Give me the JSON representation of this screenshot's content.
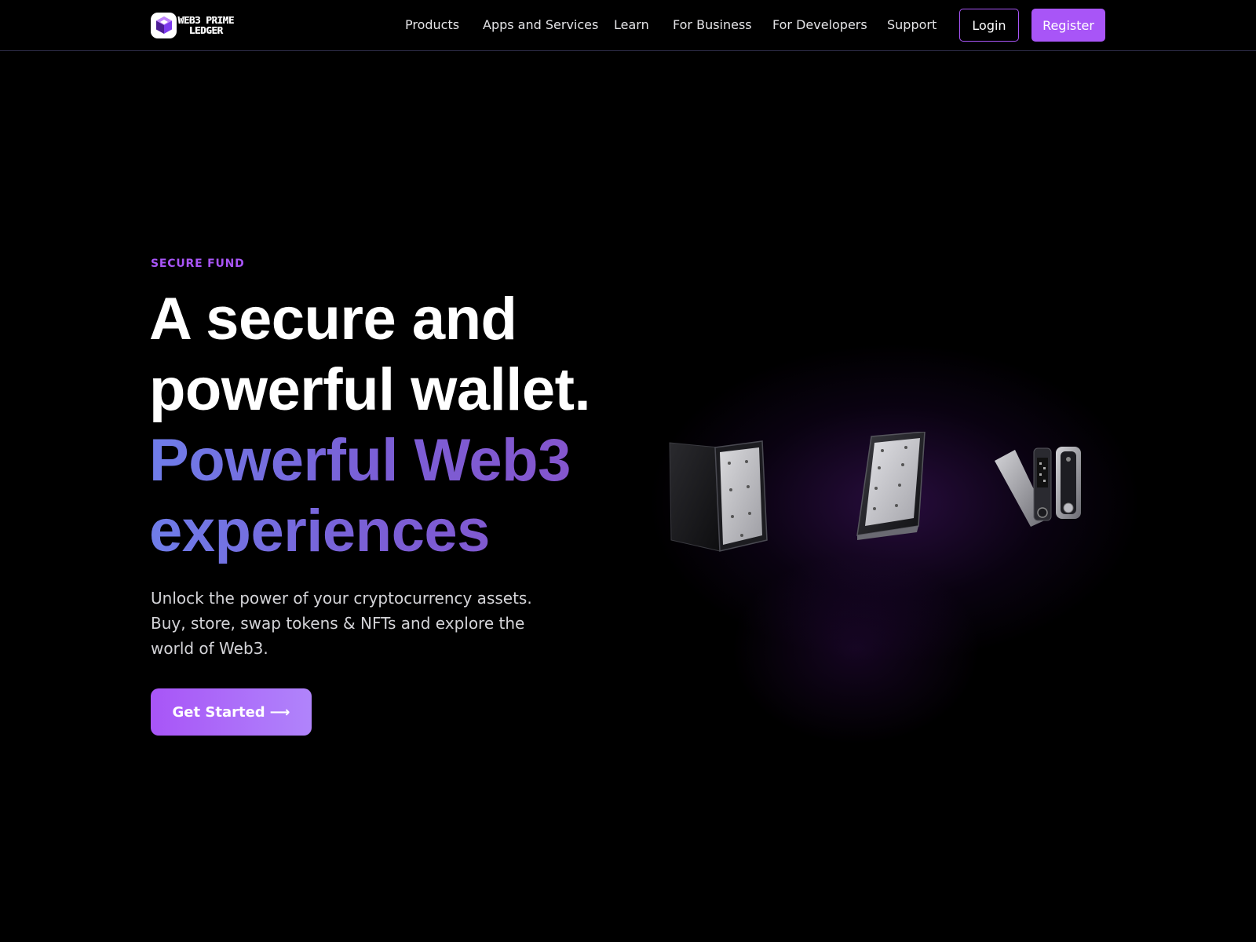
{
  "brand": {
    "name_line1": "WEB3 PRIME",
    "name_line2": "LEDGER",
    "logo_icon": "cube-logo-icon",
    "accent_color": "#a855f7"
  },
  "nav": {
    "items": [
      {
        "label": "Products"
      },
      {
        "label": "Apps and Services"
      },
      {
        "label": "Learn"
      },
      {
        "label": "For Business"
      },
      {
        "label": "For Developers"
      },
      {
        "label": "Support"
      }
    ],
    "login_label": "Login",
    "register_label": "Register"
  },
  "hero": {
    "eyebrow": "SECURE FUND",
    "headline_line1": "A secure and",
    "headline_line2": "powerful wallet.",
    "accent_line1": "Powerful Web3",
    "accent_line2": "experiences",
    "subtext": "Unlock the power of your cryptocurrency assets. Buy, store, swap tokens & NFTs and explore the world of Web3.",
    "cta_label": "Get Started",
    "cta_icon": "arrow-right-icon",
    "cta_arrow": "⟶"
  },
  "devices": [
    {
      "icon": "hardware-wallet-flex-icon"
    },
    {
      "icon": "hardware-wallet-stax-icon"
    },
    {
      "icon": "hardware-wallet-nano-icon"
    }
  ]
}
